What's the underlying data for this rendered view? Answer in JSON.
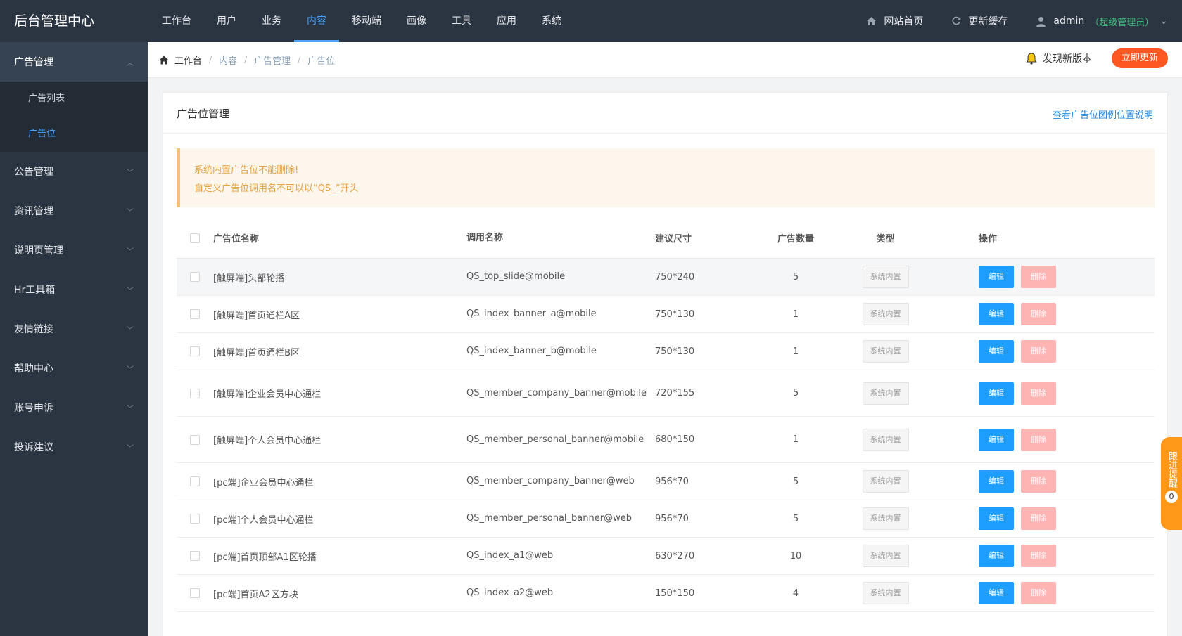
{
  "brand": "后台管理中心",
  "topnav": [
    {
      "label": "工作台"
    },
    {
      "label": "用户"
    },
    {
      "label": "业务"
    },
    {
      "label": "内容",
      "active": true
    },
    {
      "label": "移动端"
    },
    {
      "label": "画像"
    },
    {
      "label": "工具"
    },
    {
      "label": "应用"
    },
    {
      "label": "系统"
    }
  ],
  "topright": {
    "home_label": "网站首页",
    "cache_label": "更新缓存",
    "user_name": "admin",
    "user_role": "（超级管理员）"
  },
  "sidebar": {
    "active_group": "广告管理",
    "sub_items": [
      {
        "label": "广告列表"
      },
      {
        "label": "广告位",
        "active": true
      }
    ],
    "groups": [
      {
        "label": "公告管理"
      },
      {
        "label": "资讯管理"
      },
      {
        "label": "说明页管理"
      },
      {
        "label": "Hr工具箱"
      },
      {
        "label": "友情链接"
      },
      {
        "label": "帮助中心"
      },
      {
        "label": "账号申诉"
      },
      {
        "label": "投诉建议"
      }
    ]
  },
  "breadcrumb": [
    "工作台",
    "内容",
    "广告管理",
    "广告位"
  ],
  "update": {
    "notice": "发现新版本",
    "button": "立即更新"
  },
  "card": {
    "title": "广告位管理",
    "help_link": "查看广告位图例位置说明"
  },
  "alert": {
    "line1": "系统内置广告位不能删除!",
    "line2": "自定义广告位调用名不可以以“QS_”开头"
  },
  "table": {
    "headers": {
      "name": "广告位名称",
      "call": "调用名称",
      "size": "建议尺寸",
      "count": "广告数量",
      "type": "类型",
      "ops": "操作"
    },
    "tag_label": "系统内置",
    "edit_label": "编辑",
    "delete_label": "删除",
    "rows": [
      {
        "name": "[触屏端]头部轮播",
        "call": "QS_top_slide@mobile",
        "size": "750*240",
        "count": "5"
      },
      {
        "name": "[触屏端]首页通栏A区",
        "call": "QS_index_banner_a@mobile",
        "size": "750*130",
        "count": "1"
      },
      {
        "name": "[触屏端]首页通栏B区",
        "call": "QS_index_banner_b@mobile",
        "size": "750*130",
        "count": "1"
      },
      {
        "name": "[触屏端]企业会员中心通栏",
        "call": "QS_member_company_banner@mobile",
        "size": "720*155",
        "count": "5"
      },
      {
        "name": "[触屏端]个人会员中心通栏",
        "call": "QS_member_personal_banner@mobile",
        "size": "680*150",
        "count": "1"
      },
      {
        "name": "[pc端]企业会员中心通栏",
        "call": "QS_member_company_banner@web",
        "size": "956*70",
        "count": "5"
      },
      {
        "name": "[pc端]个人会员中心通栏",
        "call": "QS_member_personal_banner@web",
        "size": "956*70",
        "count": "5"
      },
      {
        "name": "[pc端]首页顶部A1区轮播",
        "call": "QS_index_a1@web",
        "size": "630*270",
        "count": "10"
      },
      {
        "name": "[pc端]首页A2区方块",
        "call": "QS_index_a2@web",
        "size": "150*150",
        "count": "4"
      }
    ]
  },
  "float_tab": {
    "label": "跟进提醒",
    "count": "0"
  }
}
